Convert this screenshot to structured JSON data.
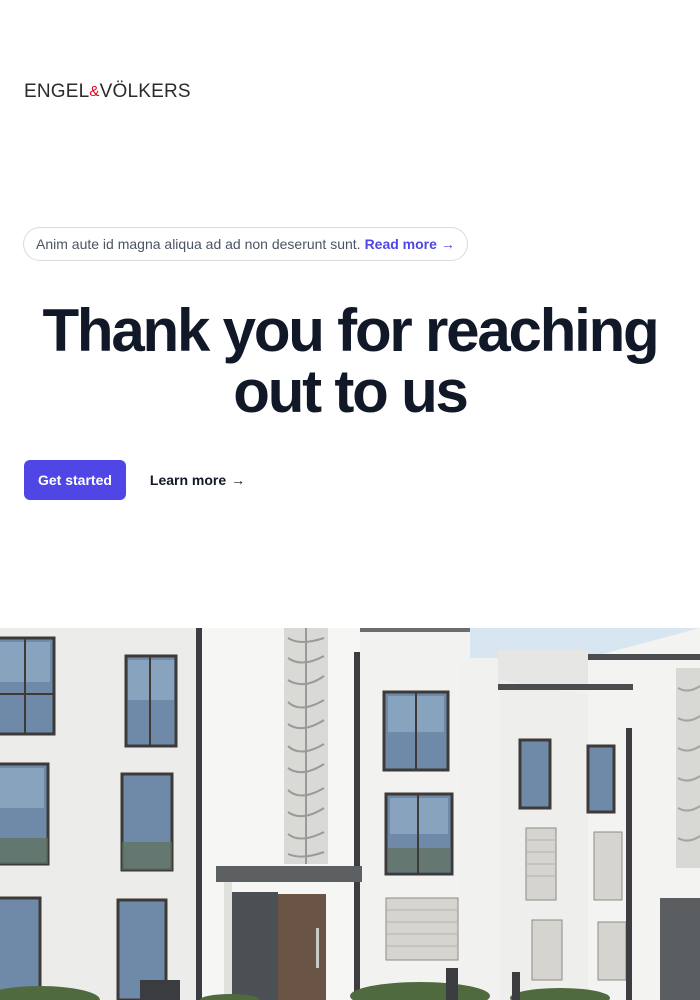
{
  "brand": {
    "logo_part1": "ENGEL",
    "logo_amp": "&",
    "logo_part2": "VÖLKERS",
    "accent_color": "#e2001a"
  },
  "announcement": {
    "text": "Anim aute id magna aliqua ad ad non deserunt sunt.",
    "link_label": "Read more",
    "link_arrow": "→"
  },
  "hero": {
    "title_line1": "Thank you for reaching",
    "title_line2": "out to us"
  },
  "actions": {
    "primary_label": "Get started",
    "primary_color": "#4f46e5",
    "secondary_label": "Learn more",
    "secondary_arrow": "→"
  },
  "image": {
    "subject": "white-apartment-building-photo"
  }
}
